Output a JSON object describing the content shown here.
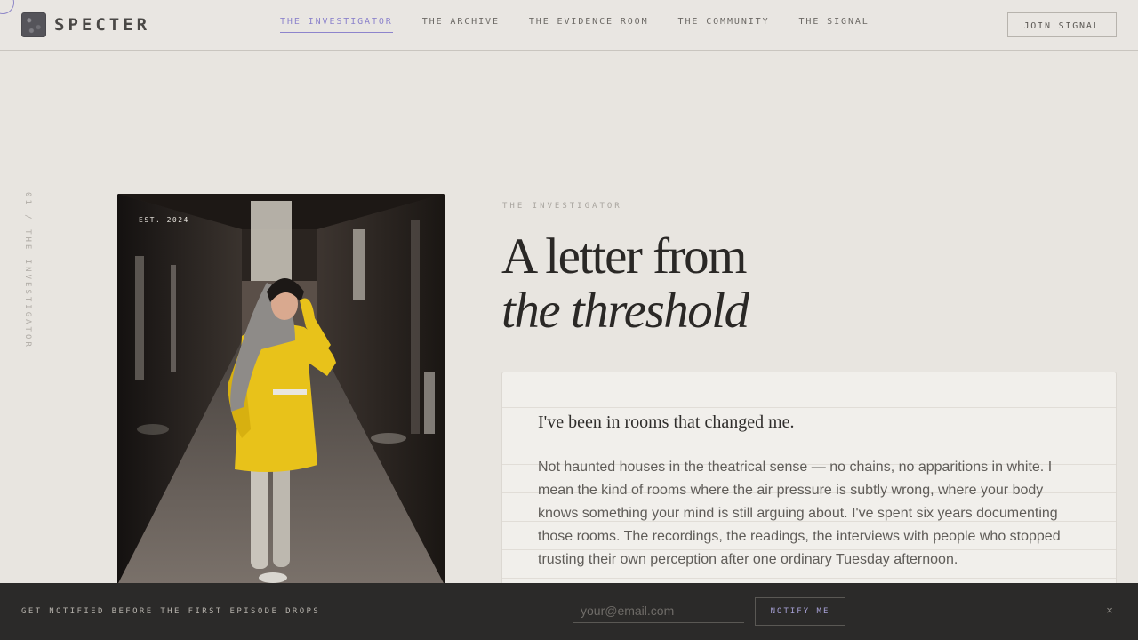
{
  "brand": {
    "name": "SPECTER"
  },
  "nav": {
    "items": [
      {
        "label": "THE INVESTIGATOR",
        "active": true
      },
      {
        "label": "THE ARCHIVE",
        "active": false
      },
      {
        "label": "THE EVIDENCE ROOM",
        "active": false
      },
      {
        "label": "THE COMMUNITY",
        "active": false
      },
      {
        "label": "THE SIGNAL",
        "active": false
      }
    ],
    "cta_label": "JOIN SIGNAL"
  },
  "side": {
    "vertical_label": "01 / THE INVESTIGATOR"
  },
  "hero": {
    "photo_badge": "EST. 2024",
    "eyebrow": "THE INVESTIGATOR",
    "headline_line1": "A letter from",
    "headline_line2": "the threshold"
  },
  "letter": {
    "greeting": "I've been in rooms that changed me.",
    "body": "Not haunted houses in the theatrical sense — no chains, no apparitions in white. I mean the kind of rooms where the air pressure is subtly wrong, where your body knows something your mind is still arguing about. I've spent six years documenting those rooms. The recordings, the readings, the interviews with people who stopped trusting their own perception after one ordinary Tuesday afternoon."
  },
  "banner": {
    "text": "GET NOTIFIED BEFORE THE FIRST EPISODE DROPS",
    "email_placeholder": "your@email.com",
    "notify_label": "NOTIFY ME",
    "close_label": "×"
  },
  "colors": {
    "accent": "#8d84cc",
    "page_bg": "#e8e5e0",
    "banner_bg": "#2b2a29"
  }
}
